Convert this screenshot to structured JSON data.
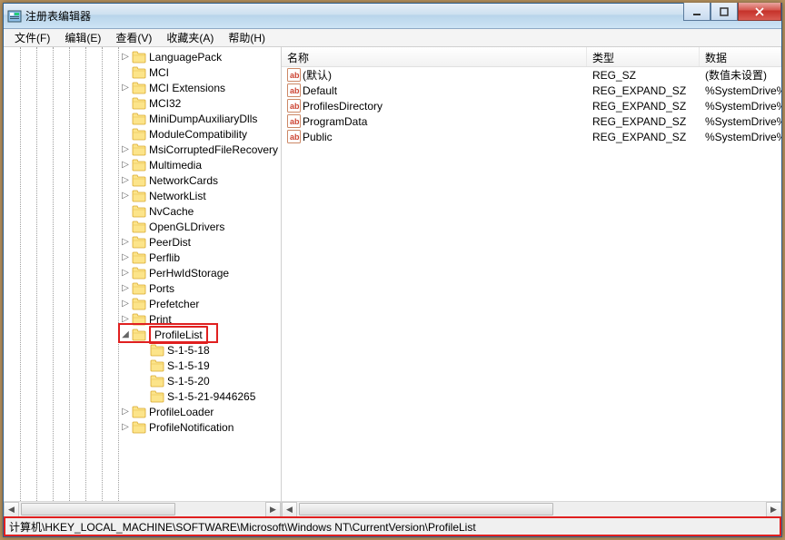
{
  "window": {
    "title": "注册表编辑器"
  },
  "menu": {
    "file": "文件(F)",
    "edit": "编辑(E)",
    "view": "查看(V)",
    "favorites": "收藏夹(A)",
    "help": "帮助(H)"
  },
  "tree": {
    "items": [
      {
        "indent": 128,
        "exp": "▷",
        "label": "LanguagePack"
      },
      {
        "indent": 128,
        "exp": "",
        "label": "MCI"
      },
      {
        "indent": 128,
        "exp": "▷",
        "label": "MCI Extensions"
      },
      {
        "indent": 128,
        "exp": "",
        "label": "MCI32"
      },
      {
        "indent": 128,
        "exp": "",
        "label": "MiniDumpAuxiliaryDlls"
      },
      {
        "indent": 128,
        "exp": "",
        "label": "ModuleCompatibility"
      },
      {
        "indent": 128,
        "exp": "▷",
        "label": "MsiCorruptedFileRecovery"
      },
      {
        "indent": 128,
        "exp": "▷",
        "label": "Multimedia"
      },
      {
        "indent": 128,
        "exp": "▷",
        "label": "NetworkCards"
      },
      {
        "indent": 128,
        "exp": "▷",
        "label": "NetworkList"
      },
      {
        "indent": 128,
        "exp": "",
        "label": "NvCache"
      },
      {
        "indent": 128,
        "exp": "",
        "label": "OpenGLDrivers"
      },
      {
        "indent": 128,
        "exp": "▷",
        "label": "PeerDist"
      },
      {
        "indent": 128,
        "exp": "▷",
        "label": "Perflib"
      },
      {
        "indent": 128,
        "exp": "▷",
        "label": "PerHwIdStorage"
      },
      {
        "indent": 128,
        "exp": "▷",
        "label": "Ports"
      },
      {
        "indent": 128,
        "exp": "▷",
        "label": "Prefetcher"
      },
      {
        "indent": 128,
        "exp": "▷",
        "label": "Print"
      },
      {
        "indent": 128,
        "exp": "◢",
        "label": "ProfileList",
        "selected": true
      },
      {
        "indent": 148,
        "exp": "",
        "label": "S-1-5-18"
      },
      {
        "indent": 148,
        "exp": "",
        "label": "S-1-5-19"
      },
      {
        "indent": 148,
        "exp": "",
        "label": "S-1-5-20"
      },
      {
        "indent": 148,
        "exp": "",
        "label": "S-1-5-21-9446265"
      },
      {
        "indent": 128,
        "exp": "▷",
        "label": "ProfileLoader"
      },
      {
        "indent": 128,
        "exp": "▷",
        "label": "ProfileNotification"
      }
    ]
  },
  "list": {
    "columns": {
      "name": "名称",
      "type": "类型",
      "data": "数据"
    },
    "col_widths": {
      "name": 336,
      "type": 124,
      "data": 120
    },
    "rows": [
      {
        "name": "(默认)",
        "type": "REG_SZ",
        "data": "(数值未设置)"
      },
      {
        "name": "Default",
        "type": "REG_EXPAND_SZ",
        "data": "%SystemDrive%"
      },
      {
        "name": "ProfilesDirectory",
        "type": "REG_EXPAND_SZ",
        "data": "%SystemDrive%"
      },
      {
        "name": "ProgramData",
        "type": "REG_EXPAND_SZ",
        "data": "%SystemDrive%"
      },
      {
        "name": "Public",
        "type": "REG_EXPAND_SZ",
        "data": "%SystemDrive%"
      }
    ]
  },
  "statusbar": {
    "path": "计算机\\HKEY_LOCAL_MACHINE\\SOFTWARE\\Microsoft\\Windows NT\\CurrentVersion\\ProfileList"
  }
}
